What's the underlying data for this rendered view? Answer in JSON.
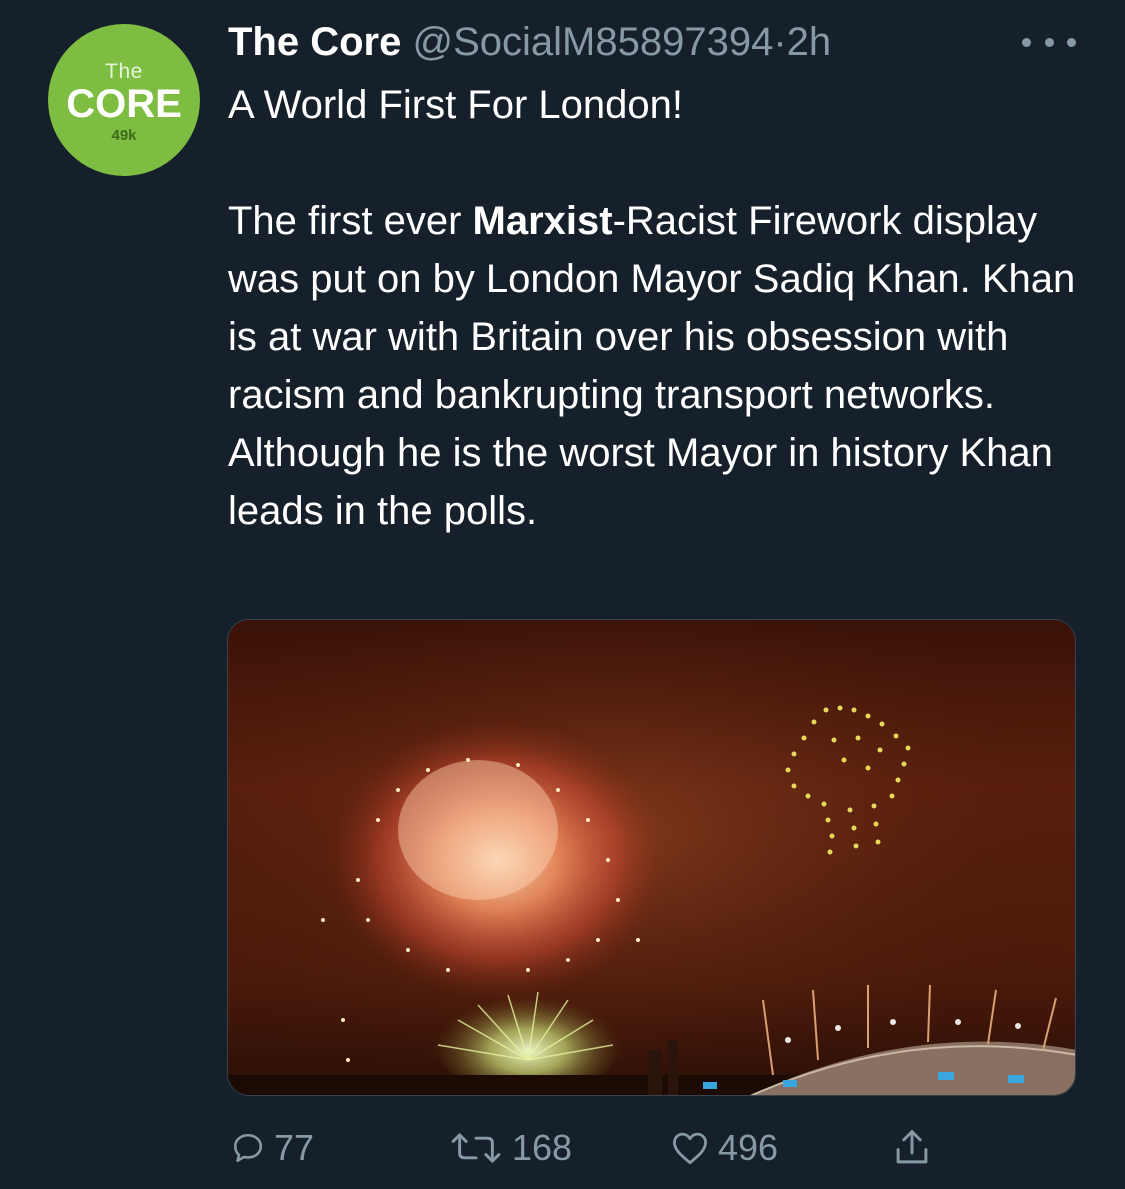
{
  "author": {
    "display_name": "The Core",
    "handle": "@SocialM85897394",
    "separator": "·",
    "time": "2h",
    "avatar": {
      "line1": "The",
      "line2": "CORE",
      "line3": "49k",
      "color": "#7cbd42"
    }
  },
  "tweet": {
    "headline": "A World First For London!",
    "body_pre": "The first ever ",
    "body_bold": "Marxist",
    "body_post": "-Racist Firework display was put on by London Mayor Sadiq Khan. Khan is at war with Britain over his obsession with racism and bankrupting transport networks. Although he is the worst Mayor in history Khan leads in the polls."
  },
  "actions": {
    "reply_count": "77",
    "retweet_count": "168",
    "like_count": "496"
  },
  "colors": {
    "background": "#15202b",
    "secondary_text": "#8899a6",
    "primary_text": "#ffffff",
    "border": "#38444d"
  },
  "icons": {
    "more": "more-dots-icon",
    "reply": "reply-icon",
    "retweet": "retweet-icon",
    "like": "heart-icon",
    "share": "share-icon"
  }
}
